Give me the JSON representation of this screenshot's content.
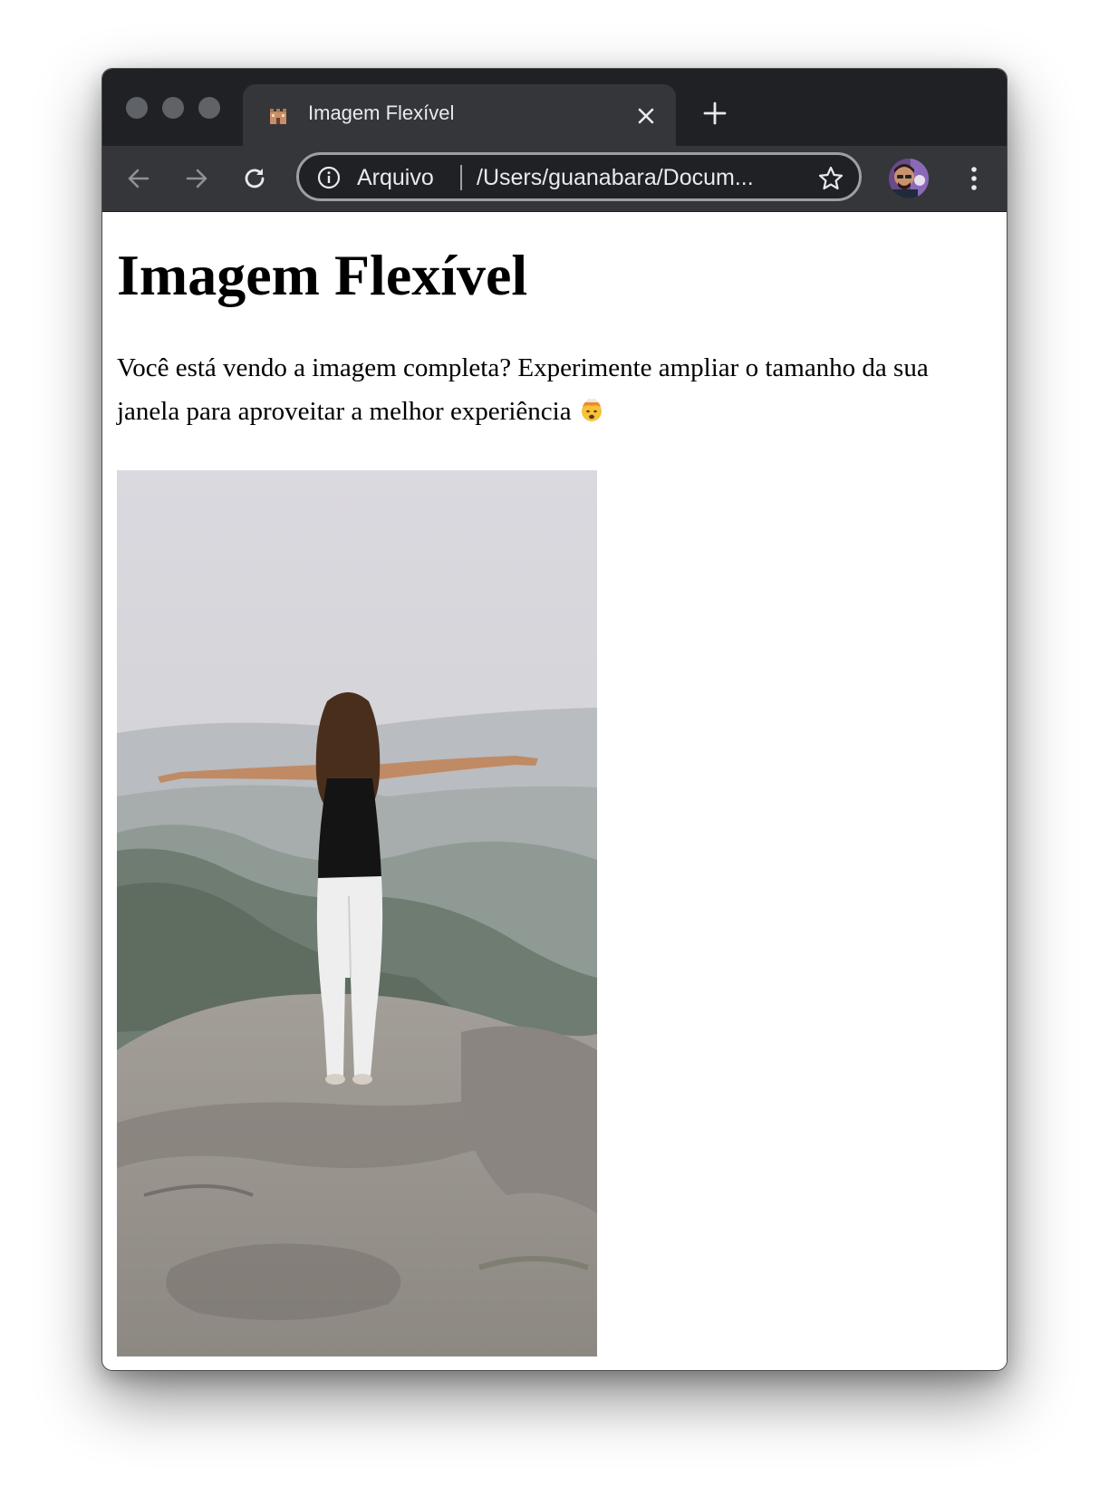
{
  "browser": {
    "tab": {
      "title": "Imagem Flexível",
      "favicon": "castle-icon"
    },
    "toolbar": {
      "scheme_label": "Arquivo",
      "url": "/Users/guanabara/Docum...",
      "icons": [
        "back-arrow-icon",
        "forward-arrow-icon",
        "reload-icon",
        "info-icon",
        "star-icon",
        "kebab-menu-icon"
      ]
    },
    "colors": {
      "tabstrip": "#202124",
      "toolbar": "#35363a",
      "text": "#e8eaed"
    }
  },
  "page": {
    "heading": "Imagem Flexível",
    "paragraph": "Você está vendo a imagem completa? Experimente ampliar o tamanho da sua janela para aproveitar a melhor experiência",
    "emoji": "exploding-head-emoji",
    "image_subject": "woman-with-open-arms-on-mountain-rock"
  }
}
